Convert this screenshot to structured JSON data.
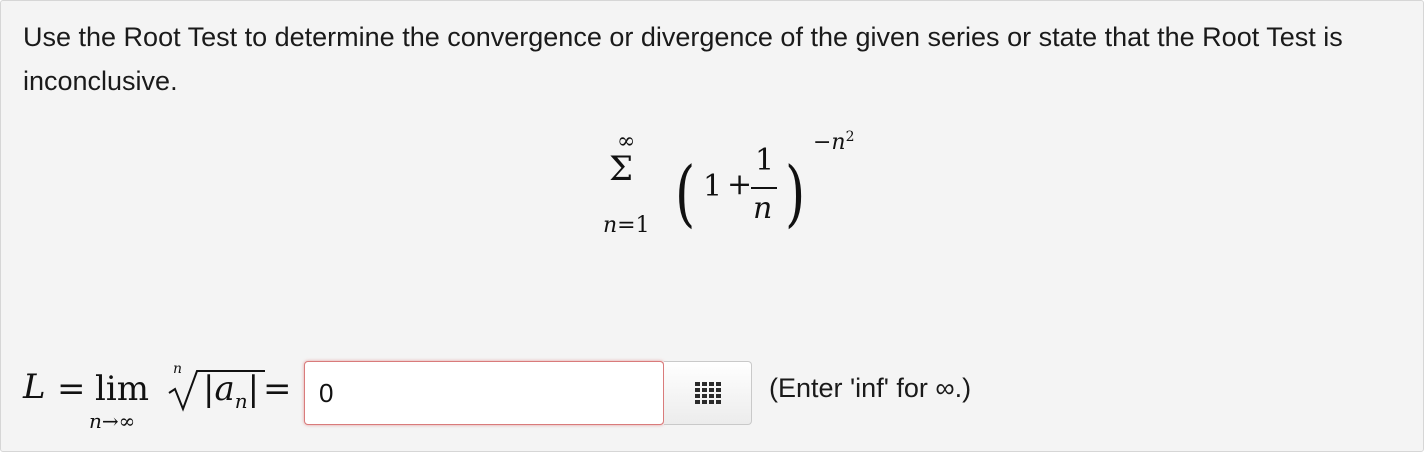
{
  "question": {
    "text": "Use the Root Test to determine the convergence or divergence of the given series or state that the Root Test is inconclusive."
  },
  "series": {
    "upper_limit": "∞",
    "sigma": "Σ",
    "index_var": "n",
    "index_eq": "=1",
    "one": "1",
    "plus": "+",
    "numerator": "1",
    "denominator": "n",
    "exponent_prefix": "−n",
    "exponent_power": "2"
  },
  "limit_expr": {
    "L": "L",
    "eq": "=",
    "lim": "lim",
    "sub_var": "n",
    "sub_arrow": "→∞",
    "root_index": "n",
    "abs_open": "|",
    "a": "a",
    "a_sub": "n",
    "abs_close": "|",
    "eq2": "="
  },
  "answer": {
    "value": "0"
  },
  "palette_button": {
    "icon": "keypad-grid-icon"
  },
  "hint": {
    "text": "(Enter 'inf' for ∞.)"
  },
  "colors": {
    "input_border_error": "#d97b7b",
    "panel_bg": "#f4f4f4"
  }
}
